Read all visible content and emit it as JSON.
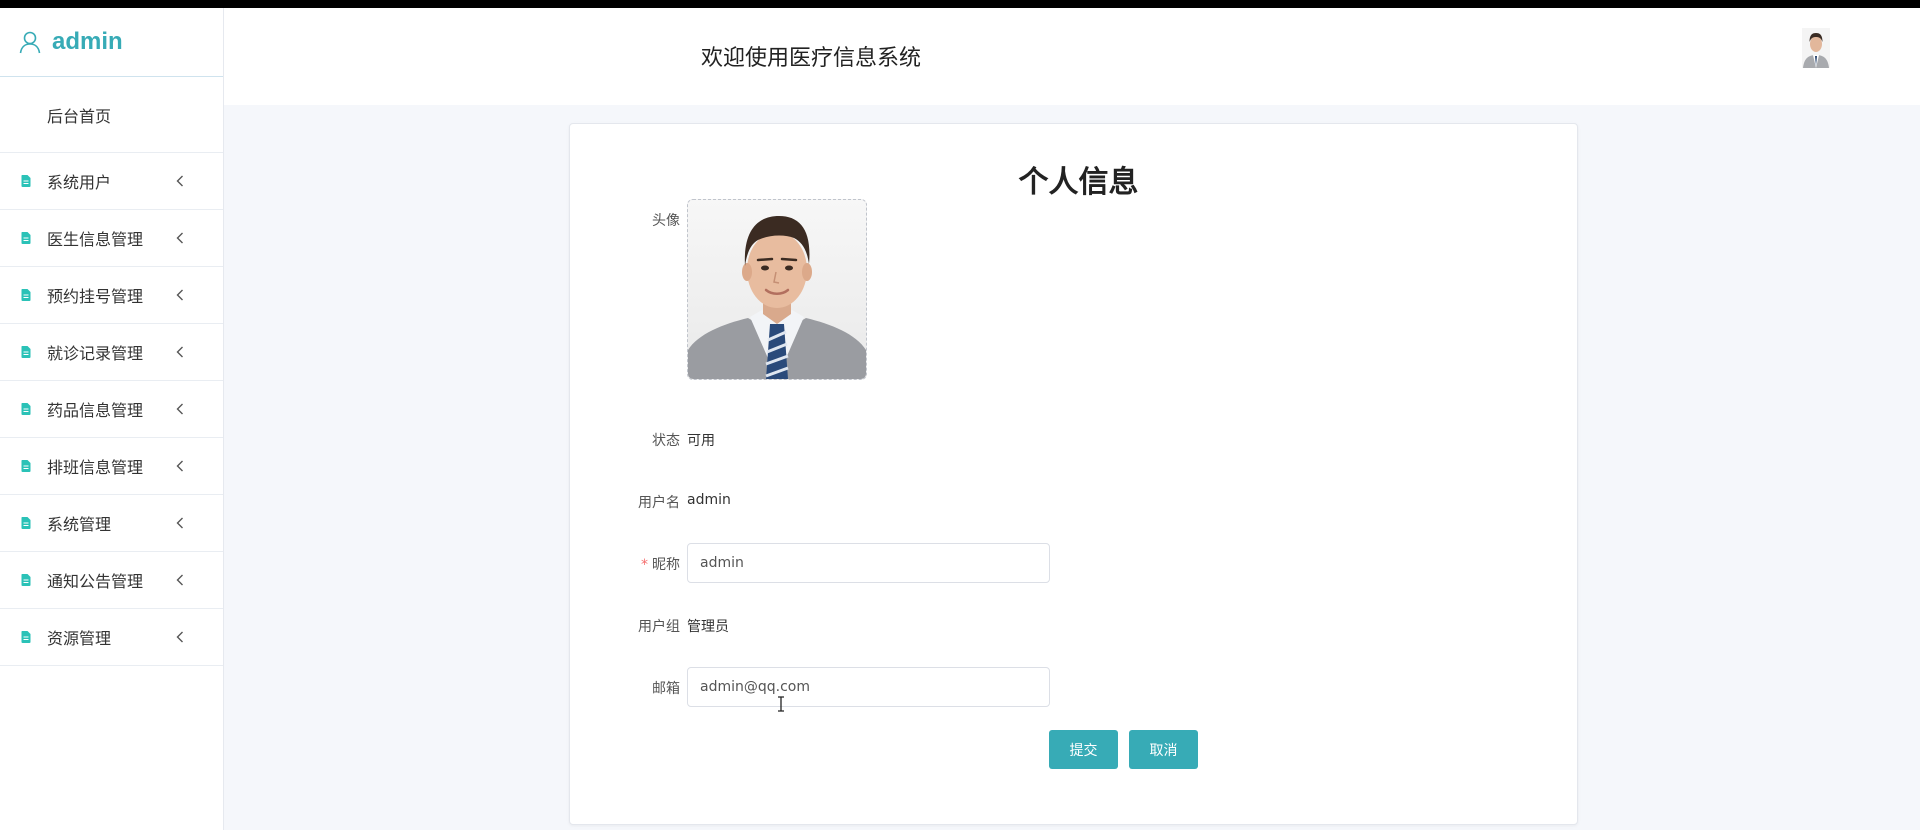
{
  "sidebar": {
    "brand": "admin",
    "home": "后台首页",
    "items": [
      {
        "label": "系统用户"
      },
      {
        "label": "医生信息管理"
      },
      {
        "label": "预约挂号管理"
      },
      {
        "label": "就诊记录管理"
      },
      {
        "label": "药品信息管理"
      },
      {
        "label": "排班信息管理"
      },
      {
        "label": "系统管理"
      },
      {
        "label": "通知公告管理"
      },
      {
        "label": "资源管理"
      }
    ]
  },
  "header": {
    "title": "欢迎使用医疗信息系统"
  },
  "profile": {
    "title": "个人信息",
    "avatar_label": "头像",
    "status_label": "状态",
    "status_value": "可用",
    "username_label": "用户名",
    "username_value": "admin",
    "nickname_required_mark": "*",
    "nickname_label": "昵称",
    "nickname_value": "admin",
    "group_label": "用户组",
    "group_value": "管理员",
    "email_label": "邮箱",
    "email_value": "admin@qq.com",
    "submit_label": "提交",
    "cancel_label": "取消"
  },
  "colors": {
    "accent": "#37abb6",
    "menu_icon": "#2bc2b7",
    "required": "#f56c6c"
  },
  "icons": {
    "brand": "user-icon",
    "menu": "document-icon",
    "expand": "chevron-left-icon",
    "avatar": "person-photo-icon",
    "pointer": "text-cursor-icon"
  }
}
